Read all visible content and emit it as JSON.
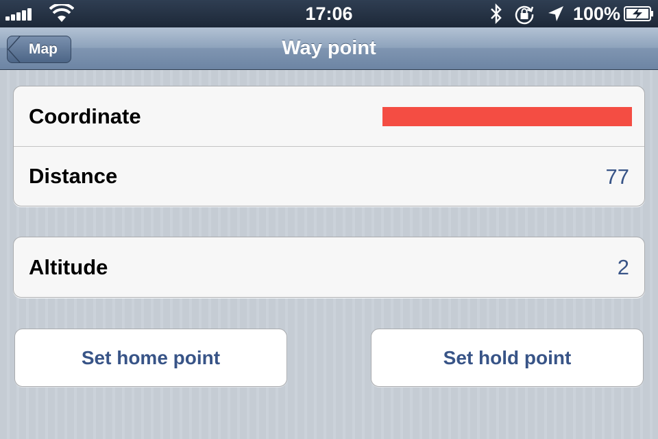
{
  "status_bar": {
    "time": "17:06",
    "battery_percent": "100%",
    "signal_icon": "signal-bars-icon",
    "wifi_icon": "wifi-icon",
    "bluetooth_icon": "bluetooth-icon",
    "rotation_lock_icon": "rotation-lock-icon",
    "location_icon": "location-arrow-icon",
    "battery_icon": "battery-charging-icon"
  },
  "nav_bar": {
    "back_label": "Map",
    "title": "Way point"
  },
  "details": {
    "rows": [
      {
        "label": "Coordinate",
        "value": ""
      },
      {
        "label": "Distance",
        "value": "77"
      }
    ]
  },
  "altitude": {
    "label": "Altitude",
    "value": "2"
  },
  "actions": {
    "set_home_label": "Set home point",
    "set_hold_label": "Set hold point"
  },
  "colors": {
    "value_text": "#385487",
    "redaction": "#f44d43",
    "nav_bar": "#8ea3bc",
    "background": "#c5ccd4"
  }
}
